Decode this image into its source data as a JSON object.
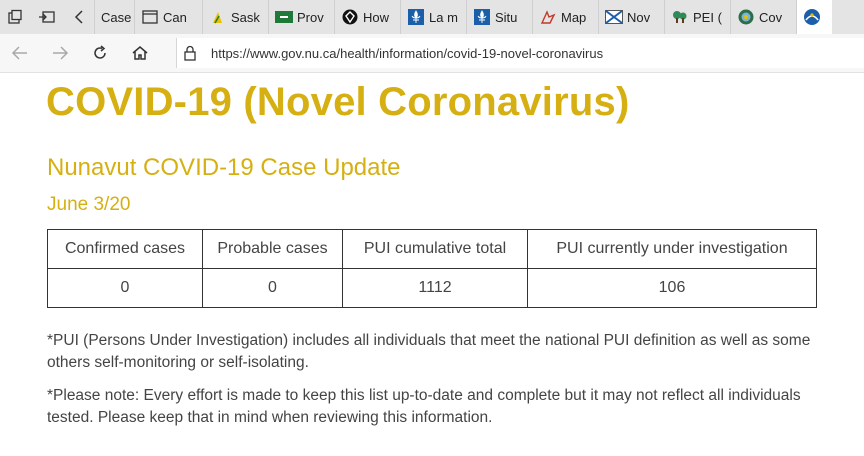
{
  "browser": {
    "tabs": [
      {
        "label": "Case",
        "icon": "page-icon"
      },
      {
        "label": "Can",
        "icon": "page-icon"
      },
      {
        "label": "Sask",
        "icon": "saskatchewan-icon"
      },
      {
        "label": "Prov",
        "icon": "manitoba-icon"
      },
      {
        "label": "How",
        "icon": "ontario-icon"
      },
      {
        "label": "La m",
        "icon": "quebec-fleur-icon"
      },
      {
        "label": "Situ",
        "icon": "quebec-fleur-icon"
      },
      {
        "label": "Map",
        "icon": "map-icon"
      },
      {
        "label": "Nov",
        "icon": "nova-scotia-icon"
      },
      {
        "label": "PEI (",
        "icon": "pei-icon"
      },
      {
        "label": "Cov",
        "icon": "newfoundland-icon"
      },
      {
        "label": "",
        "icon": "nunavut-icon"
      }
    ],
    "url": "https://www.gov.nu.ca/health/information/covid-19-novel-coronavirus"
  },
  "page": {
    "title": "COVID-19 (Novel Coronavirus)",
    "subtitle": "Nunavut COVID-19 Case Update",
    "date": "June 3/20",
    "table": {
      "headers": [
        "Confirmed cases",
        "Probable cases",
        "PUI cumulative total",
        "PUI currently under investigation"
      ],
      "row": [
        "0",
        "0",
        "1112",
        "106"
      ]
    },
    "note1": "*PUI (Persons Under Investigation) includes all individuals that meet the national PUI definition as well as some others self-monitoring or self-isolating.",
    "note2": "*Please note: Every effort is made to keep this list up-to-date and complete but it may not reflect all individuals tested. Please keep that in mind when reviewing this information."
  },
  "colors": {
    "accent": "#d6b012",
    "text": "#444444"
  }
}
